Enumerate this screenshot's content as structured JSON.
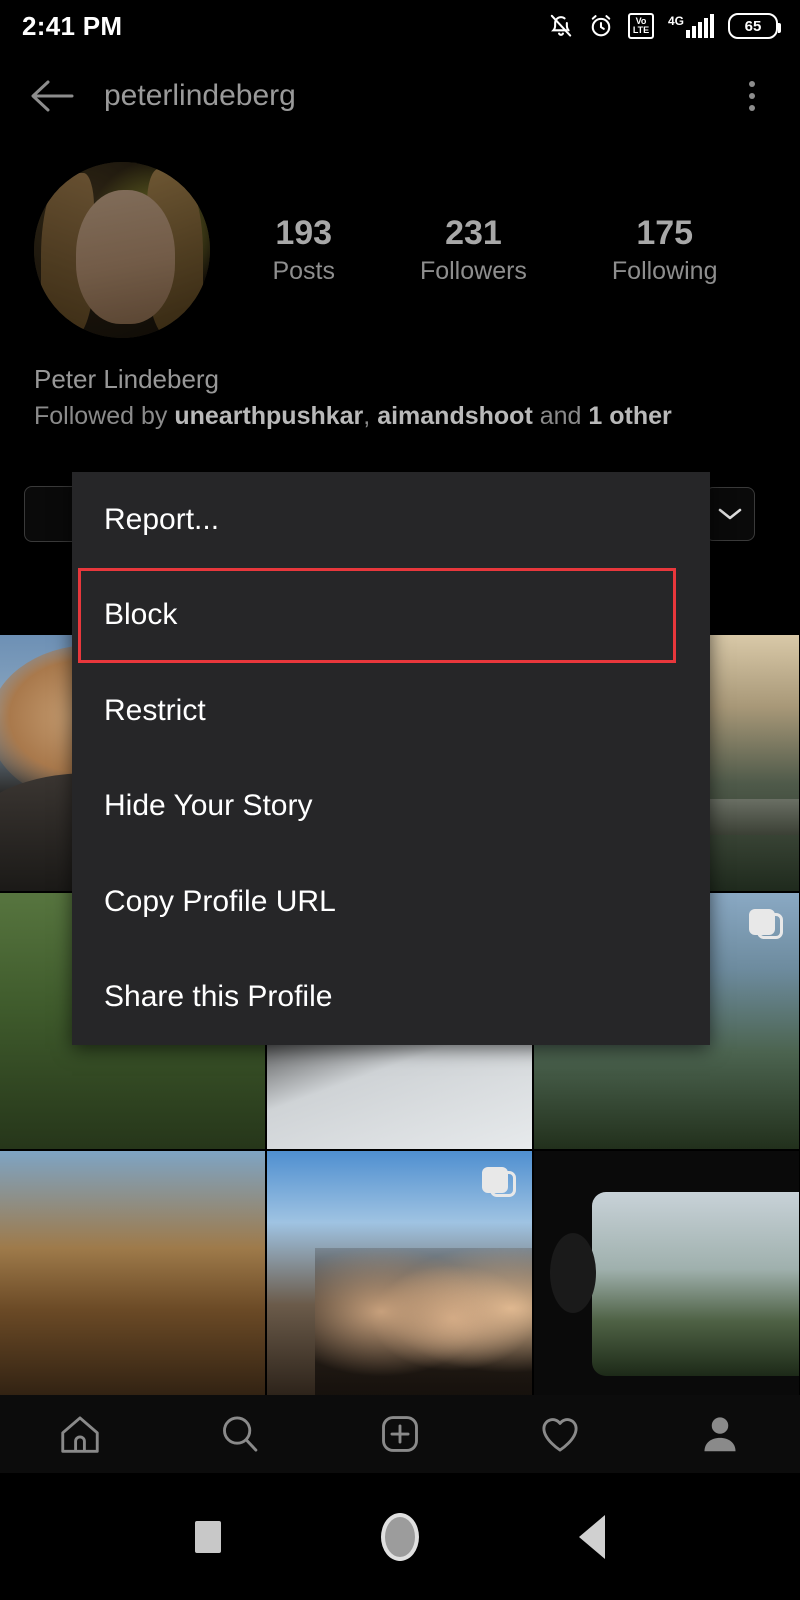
{
  "status_bar": {
    "time": "2:41 PM",
    "battery_percent": "65",
    "network_type": "4G",
    "volte_top": "Vo",
    "volte_bottom": "LTE",
    "icons": [
      "notifications-off-icon",
      "alarm-icon",
      "volte-icon",
      "signal-icon",
      "battery-icon"
    ]
  },
  "app_bar": {
    "title": "peterlindeberg",
    "back_icon": "back-arrow-icon",
    "overflow_icon": "overflow-menu-icon"
  },
  "profile": {
    "avatar_alt": "profile-avatar",
    "full_name": "Peter Lindeberg",
    "followed_by_prefix": "Followed by ",
    "followed_by_user1": "unearthpushkar",
    "followed_by_sep": ", ",
    "followed_by_user2": "aimandshoot",
    "followed_by_and": " and ",
    "followed_by_others": "1 other",
    "stats": [
      {
        "value": "193",
        "label": "Posts"
      },
      {
        "value": "231",
        "label": "Followers"
      },
      {
        "value": "175",
        "label": "Following"
      }
    ]
  },
  "menu": {
    "background_color": "#262628",
    "highlight_color": "#e8373c",
    "items": [
      {
        "label": "Report...",
        "highlighted": false
      },
      {
        "label": "Block",
        "highlighted": true
      },
      {
        "label": "Restrict",
        "highlighted": false
      },
      {
        "label": "Hide Your Story",
        "highlighted": false
      },
      {
        "label": "Copy Profile URL",
        "highlighted": false
      },
      {
        "label": "Share this Profile",
        "highlighted": false
      }
    ]
  },
  "grid": {
    "cells": [
      {
        "id": "post-1",
        "multi": false
      },
      {
        "id": "post-2",
        "multi": false
      },
      {
        "id": "post-3",
        "multi": false
      },
      {
        "id": "post-4",
        "multi": false
      },
      {
        "id": "post-5",
        "multi": false
      },
      {
        "id": "post-6",
        "multi": true
      },
      {
        "id": "post-7",
        "multi": false
      },
      {
        "id": "post-8",
        "multi": true
      },
      {
        "id": "post-9",
        "multi": false
      }
    ]
  },
  "bottom_nav": {
    "items": [
      {
        "icon": "home-icon"
      },
      {
        "icon": "search-icon"
      },
      {
        "icon": "add-post-icon"
      },
      {
        "icon": "heart-icon"
      },
      {
        "icon": "profile-icon"
      }
    ]
  },
  "system_nav": {
    "items": [
      {
        "icon": "recents-square-icon"
      },
      {
        "icon": "home-circle-icon"
      },
      {
        "icon": "back-triangle-icon"
      }
    ]
  }
}
